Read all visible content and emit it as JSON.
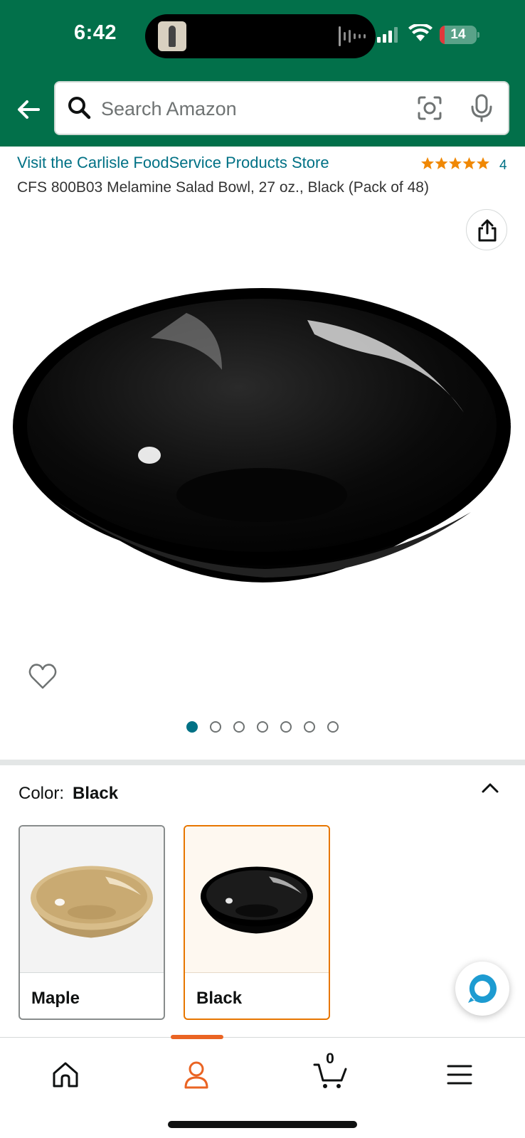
{
  "status_bar": {
    "time": "6:42",
    "battery_level": "14"
  },
  "header": {
    "search_placeholder": "Search Amazon",
    "accent_color": "#02704a"
  },
  "product": {
    "store_link": "Visit the Carlisle FoodService Products Store",
    "rating_stars": 5,
    "rating_count": "4",
    "title": "CFS 800B03 Melamine Salad Bowl, 27 oz., Black (Pack of 48)",
    "image_count": 7,
    "active_image_index": 0
  },
  "variations": {
    "color_label": "Color:",
    "selected_color": "Black",
    "options": [
      {
        "label": "Maple",
        "selected": false
      },
      {
        "label": "Black",
        "selected": true
      }
    ]
  },
  "bottom_nav": {
    "items": [
      "home-icon",
      "account-icon",
      "cart-icon",
      "menu-icon"
    ],
    "active": "account-icon",
    "cart_count": "0"
  }
}
